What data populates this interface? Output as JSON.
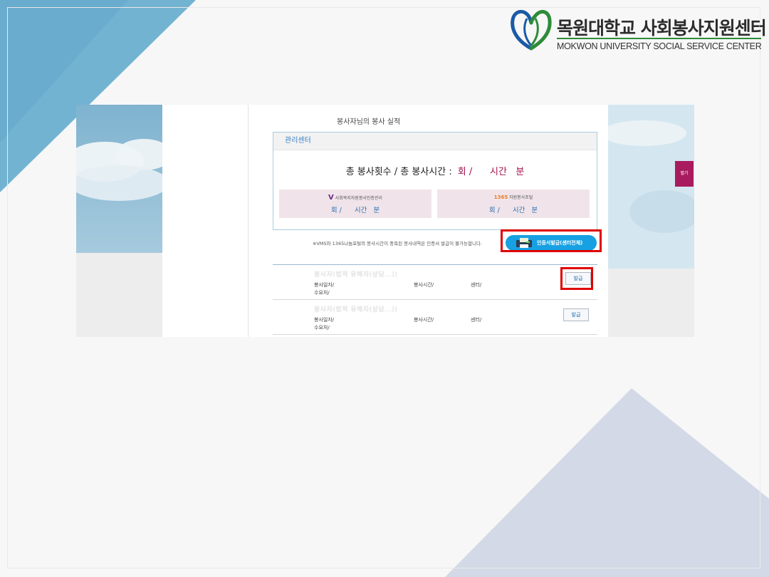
{
  "logo": {
    "korean_name": "목원대학교 사회봉사지원센터",
    "english_name": "MOKWON UNIVERSITY SOCIAL SERVICE CENTER",
    "accent_colors": [
      "#2e8b3a",
      "#1a5aa6"
    ]
  },
  "page": {
    "section_title": "봉사자님의 봉사 실적",
    "side_tab_label": "펼기"
  },
  "summary_box": {
    "header": "관리센터",
    "totals_label": "총 봉사횟수 / 총 봉사시간 :",
    "totals_value": "회 /      시간   분",
    "cards": [
      {
        "brand_mark": "V",
        "brand_text": "사회복지자원봉사인증관리",
        "value": "회 /      시간   분"
      },
      {
        "brand_mark": "1365",
        "brand_text": "자원봉사포털",
        "value": "회 /      시간   분"
      }
    ]
  },
  "notice": "※VMS와 1365나눔포털의 봉사시간이 중복된 봉사내역은 인증서 발급이 불가능합니다.",
  "certificate_button": {
    "label": "인증서발급(센터전체)",
    "icon": "certificate-printer-icon"
  },
  "records": [
    {
      "title": "봉사자(법적 유해자(상담...))",
      "date_label": "봉사일자/",
      "hours_label": "봉사시간/",
      "center_label": "센터/",
      "recipient_label": "수요처/",
      "issue_label": "발급"
    },
    {
      "title": "봉사자(법적 유해자(상담...))",
      "date_label": "봉사일자/",
      "hours_label": "봉사시간/",
      "center_label": "센터/",
      "recipient_label": "수요처/",
      "issue_label": "발급"
    }
  ],
  "colors": {
    "accent_red": "#a2124d",
    "button_blue": "#17a0e2",
    "highlight_red": "#e00000",
    "side_tab": "#a91b5f"
  }
}
